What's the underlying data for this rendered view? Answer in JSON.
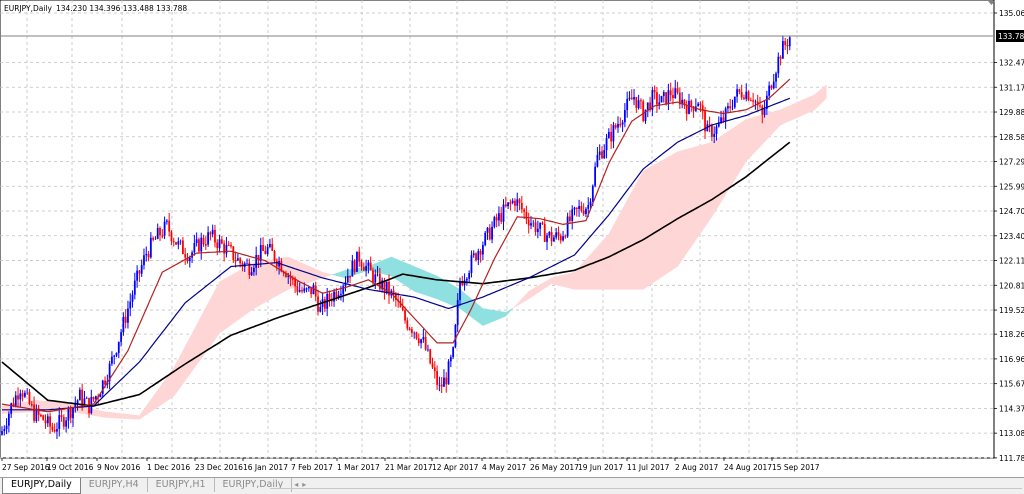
{
  "tabs": [
    "EURJPY,Daily",
    "EURJPY,H4",
    "EURJPY,H1",
    "EURJPY,Daily"
  ],
  "chart_data": {
    "type": "candlestick",
    "title": "EURJPY,Daily",
    "ohlc_readout": "134.230 134.396 133.488 133.788",
    "current_price": 133.788,
    "current_price_label": "133.788",
    "ylim": [
      111.78,
      135.06
    ],
    "y_ticks": [
      "135.060",
      "133.788",
      "132.470",
      "131.175",
      "129.880",
      "128.585",
      "127.290",
      "125.995",
      "124.700",
      "123.405",
      "122.110",
      "120.815",
      "119.520",
      "118.260",
      "116.965",
      "115.670",
      "114.375",
      "113.080",
      "111.785"
    ],
    "x_ticks": [
      "27 Sep 2016",
      "19 Oct 2016",
      "9 Nov 2016",
      "1 Dec 2016",
      "23 Dec 2016",
      "16 Jan 2017",
      "7 Feb 2017",
      "1 Mar 2017",
      "21 Mar 2017",
      "12 Apr 2017",
      "4 May 2017",
      "26 May 2017",
      "19 Jun 2017",
      "11 Jul 2017",
      "2 Aug 2017",
      "24 Aug 2017",
      "15 Sep 2017"
    ],
    "grid": true,
    "colors": {
      "bull": "#0000ff",
      "bear": "#ff0000",
      "ma_fast": "#b22222",
      "ma_mid": "#00008b",
      "ma_slow": "#000000",
      "cloud_bull": "#ffd6d6",
      "cloud_bear": "#8fe0e0"
    },
    "close_path": [
      [
        0,
        113.2
      ],
      [
        4,
        114.5
      ],
      [
        8,
        115.5
      ],
      [
        11,
        114.8
      ],
      [
        14,
        114.1
      ],
      [
        18,
        113.8
      ],
      [
        22,
        113.3
      ],
      [
        26,
        113.7
      ],
      [
        30,
        114.3
      ],
      [
        34,
        115.0
      ],
      [
        38,
        114.5
      ],
      [
        42,
        115.2
      ],
      [
        47,
        116.5
      ],
      [
        53,
        118.8
      ],
      [
        58,
        120.8
      ],
      [
        63,
        122.5
      ],
      [
        68,
        123.4
      ],
      [
        72,
        123.9
      ],
      [
        77,
        122.9
      ],
      [
        82,
        122.4
      ],
      [
        87,
        123.1
      ],
      [
        91,
        123.4
      ],
      [
        95,
        123.0
      ],
      [
        100,
        122.5
      ],
      [
        104,
        122.0
      ],
      [
        108,
        121.8
      ],
      [
        112,
        122.4
      ],
      [
        116,
        122.7
      ],
      [
        120,
        122.2
      ],
      [
        124,
        121.6
      ],
      [
        128,
        120.8
      ],
      [
        132,
        120.4
      ],
      [
        136,
        120.6
      ],
      [
        139,
        119.5
      ],
      [
        142,
        120.0
      ],
      [
        145,
        120.4
      ],
      [
        148,
        120.8
      ],
      [
        152,
        121.6
      ],
      [
        156,
        122.3
      ],
      [
        160,
        121.6
      ],
      [
        164,
        121.0
      ],
      [
        168,
        120.6
      ],
      [
        172,
        120.0
      ],
      [
        176,
        119.0
      ],
      [
        180,
        118.5
      ],
      [
        184,
        117.8
      ],
      [
        188,
        116.4
      ],
      [
        191,
        115.4
      ],
      [
        194,
        116.0
      ],
      [
        197,
        117.2
      ],
      [
        200,
        121.0
      ],
      [
        204,
        121.8
      ],
      [
        208,
        122.7
      ],
      [
        212,
        123.4
      ],
      [
        216,
        124.2
      ],
      [
        220,
        124.8
      ],
      [
        224,
        125.3
      ],
      [
        228,
        124.6
      ],
      [
        232,
        124.0
      ],
      [
        236,
        123.6
      ],
      [
        240,
        123.3
      ],
      [
        244,
        123.4
      ],
      [
        248,
        124.2
      ],
      [
        252,
        124.8
      ],
      [
        256,
        125.0
      ],
      [
        260,
        127.5
      ],
      [
        264,
        128.3
      ],
      [
        268,
        129.1
      ],
      [
        272,
        130.0
      ],
      [
        276,
        130.7
      ],
      [
        280,
        129.8
      ],
      [
        284,
        130.6
      ],
      [
        288,
        130.4
      ],
      [
        292,
        130.9
      ],
      [
        296,
        130.6
      ],
      [
        300,
        130.1
      ],
      [
        304,
        130.5
      ],
      [
        308,
        128.8
      ],
      [
        312,
        129.0
      ],
      [
        316,
        129.7
      ],
      [
        320,
        130.7
      ],
      [
        324,
        131.0
      ],
      [
        328,
        130.7
      ],
      [
        332,
        129.6
      ],
      [
        336,
        131.5
      ],
      [
        340,
        133.0
      ],
      [
        344,
        133.8
      ]
    ],
    "ma_fast": [
      [
        0,
        114.6
      ],
      [
        20,
        114.2
      ],
      [
        40,
        114.6
      ],
      [
        55,
        117.4
      ],
      [
        70,
        121.5
      ],
      [
        85,
        122.5
      ],
      [
        100,
        122.6
      ],
      [
        115,
        122.1
      ],
      [
        130,
        121.0
      ],
      [
        140,
        120.4
      ],
      [
        150,
        120.7
      ],
      [
        160,
        121.1
      ],
      [
        170,
        120.4
      ],
      [
        180,
        119.1
      ],
      [
        190,
        117.8
      ],
      [
        197,
        117.8
      ],
      [
        205,
        119.6
      ],
      [
        215,
        122.2
      ],
      [
        225,
        124.4
      ],
      [
        235,
        124.3
      ],
      [
        245,
        124.0
      ],
      [
        255,
        124.2
      ],
      [
        265,
        127.2
      ],
      [
        275,
        129.4
      ],
      [
        285,
        130.2
      ],
      [
        295,
        130.4
      ],
      [
        305,
        130.0
      ],
      [
        315,
        129.8
      ],
      [
        325,
        130.0
      ],
      [
        335,
        130.6
      ],
      [
        344,
        131.6
      ]
    ],
    "ma_mid": [
      [
        0,
        114.3
      ],
      [
        20,
        114.3
      ],
      [
        40,
        114.5
      ],
      [
        60,
        116.8
      ],
      [
        80,
        119.9
      ],
      [
        100,
        121.8
      ],
      [
        120,
        122.0
      ],
      [
        140,
        121.2
      ],
      [
        160,
        120.6
      ],
      [
        180,
        120.2
      ],
      [
        195,
        119.6
      ],
      [
        210,
        120.2
      ],
      [
        230,
        121.2
      ],
      [
        250,
        122.4
      ],
      [
        265,
        124.5
      ],
      [
        280,
        126.9
      ],
      [
        295,
        128.3
      ],
      [
        310,
        129.2
      ],
      [
        325,
        129.7
      ],
      [
        344,
        130.6
      ]
    ],
    "ma_slow": [
      [
        0,
        116.8
      ],
      [
        20,
        114.8
      ],
      [
        40,
        114.5
      ],
      [
        60,
        115.1
      ],
      [
        80,
        116.7
      ],
      [
        100,
        118.2
      ],
      [
        120,
        119.1
      ],
      [
        140,
        119.9
      ],
      [
        160,
        120.7
      ],
      [
        175,
        121.4
      ],
      [
        190,
        121.1
      ],
      [
        210,
        120.9
      ],
      [
        230,
        121.2
      ],
      [
        250,
        121.6
      ],
      [
        265,
        122.3
      ],
      [
        280,
        123.2
      ],
      [
        295,
        124.3
      ],
      [
        310,
        125.3
      ],
      [
        325,
        126.5
      ],
      [
        344,
        128.3
      ]
    ],
    "cloud_a": [
      [
        0,
        114.5
      ],
      [
        15,
        114.8
      ],
      [
        30,
        114.6
      ],
      [
        45,
        114.2
      ],
      [
        60,
        114.0
      ],
      [
        75,
        116.5
      ],
      [
        95,
        121.0
      ],
      [
        110,
        122.0
      ],
      [
        125,
        122.3
      ],
      [
        140,
        121.5
      ],
      [
        150,
        121.2
      ],
      [
        160,
        121.6
      ],
      [
        170,
        121.3
      ],
      [
        180,
        120.5
      ],
      [
        190,
        120.1
      ],
      [
        200,
        119.6
      ],
      [
        210,
        118.7
      ],
      [
        220,
        119.2
      ],
      [
        230,
        120.5
      ],
      [
        240,
        121.2
      ],
      [
        250,
        121.5
      ],
      [
        265,
        123.5
      ],
      [
        280,
        126.8
      ],
      [
        295,
        127.8
      ],
      [
        310,
        128.3
      ],
      [
        325,
        129.5
      ],
      [
        340,
        130.0
      ],
      [
        355,
        130.8
      ],
      [
        360,
        131.3
      ]
    ],
    "cloud_b": [
      [
        0,
        114.1
      ],
      [
        15,
        114.2
      ],
      [
        30,
        114.2
      ],
      [
        45,
        113.9
      ],
      [
        60,
        113.8
      ],
      [
        75,
        115.0
      ],
      [
        95,
        118.3
      ],
      [
        110,
        119.6
      ],
      [
        125,
        120.6
      ],
      [
        140,
        121.2
      ],
      [
        150,
        121.6
      ],
      [
        160,
        121.8
      ],
      [
        170,
        122.3
      ],
      [
        180,
        121.8
      ],
      [
        190,
        121.3
      ],
      [
        200,
        120.6
      ],
      [
        210,
        119.6
      ],
      [
        220,
        119.4
      ],
      [
        230,
        120.1
      ],
      [
        240,
        120.9
      ],
      [
        250,
        120.6
      ],
      [
        265,
        120.6
      ],
      [
        280,
        120.6
      ],
      [
        295,
        121.8
      ],
      [
        310,
        124.4
      ],
      [
        325,
        127.3
      ],
      [
        340,
        129.2
      ],
      [
        355,
        130.0
      ],
      [
        360,
        130.6
      ]
    ]
  }
}
